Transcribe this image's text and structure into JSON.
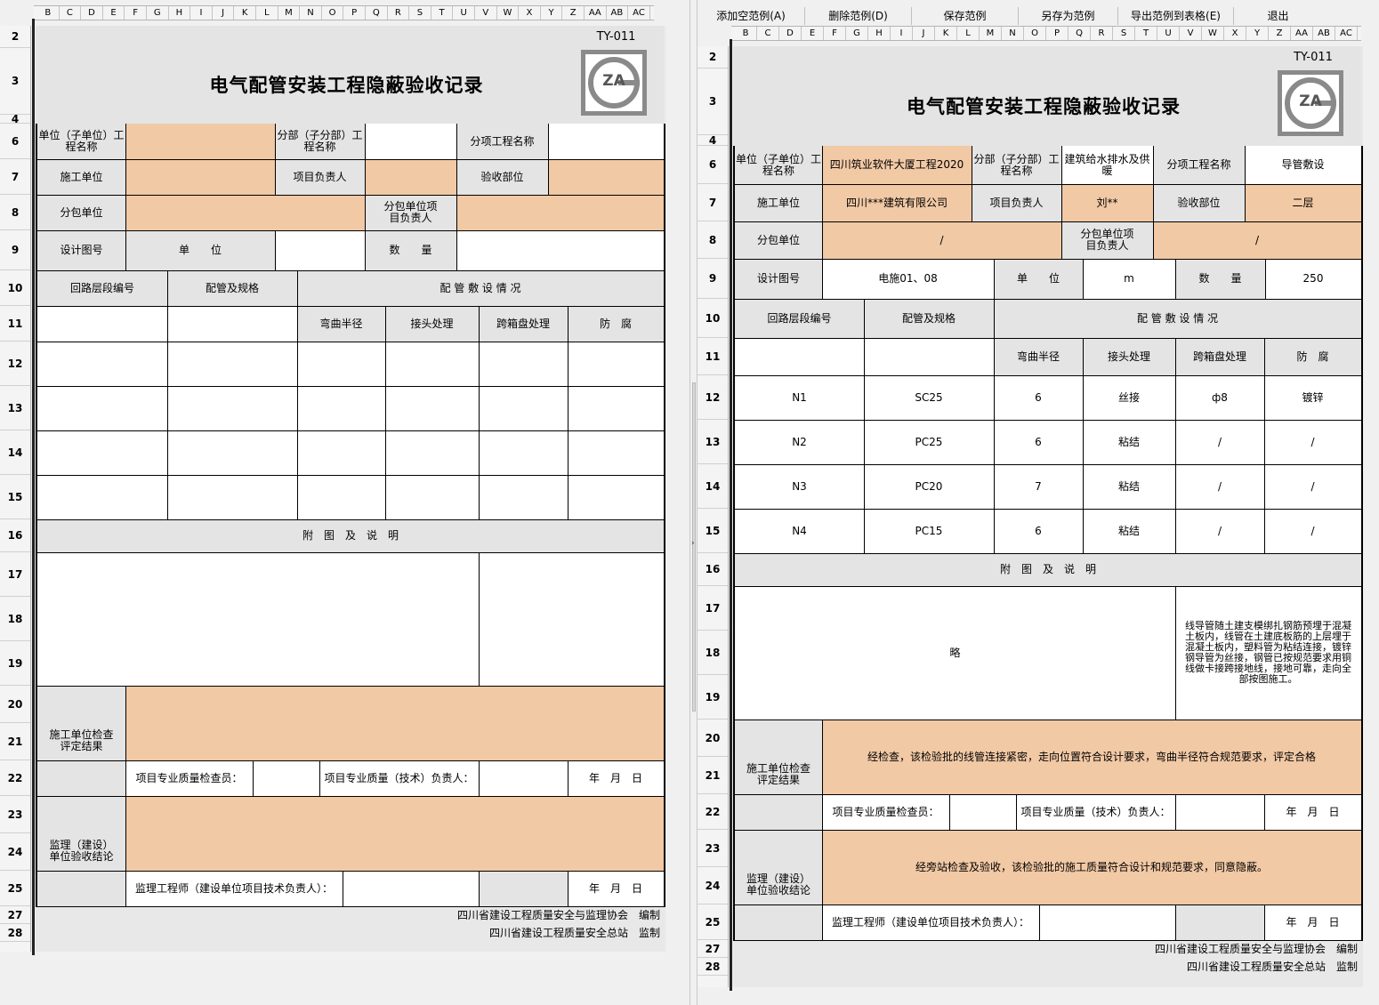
{
  "toolbar": {
    "add": "添加空范例(A)",
    "delete": "删除范例(D)",
    "save": "保存范例",
    "save_as": "另存为范例",
    "export": "导出范例到表格(E)",
    "exit": "退出"
  },
  "columns": [
    "B",
    "C",
    "D",
    "E",
    "F",
    "G",
    "H",
    "I",
    "J",
    "K",
    "L",
    "M",
    "N",
    "O",
    "P",
    "Q",
    "R",
    "S",
    "T",
    "U",
    "V",
    "W",
    "X",
    "Y",
    "Z",
    "AA",
    "AB",
    "AC"
  ],
  "rows": [
    "2",
    "3",
    "4",
    "6",
    "7",
    "8",
    "9",
    "10",
    "11",
    "12",
    "13",
    "14",
    "15",
    "16",
    "17",
    "18",
    "19",
    "20",
    "21",
    "22",
    "23",
    "24",
    "25",
    "27",
    "28"
  ],
  "form": {
    "code": "TY-011",
    "logo_text": "ZA",
    "title": "电气配管安装工程隐蔽验收记录",
    "unit_label": "单位（子单位）工程名称",
    "division_label": "分部（子分部）工程名称",
    "subitem_label": "分项工程名称",
    "contractor_label": "施工单位",
    "pm_label": "项目负责人",
    "part_label": "验收部位",
    "subcontractor_label": "分包单位",
    "sub_pm_label": "分包单位项目负责人",
    "drawing_label": "设计图号",
    "danwei_label": "单　　位",
    "qty_label": "数　　量",
    "h_circuit": "回路层段编号",
    "h_pipe": "配管及规格",
    "h_laying": "配 管 敷 设 情 况",
    "h_bend": "弯曲半径",
    "h_joint": "接头处理",
    "h_box": "跨箱盘处理",
    "h_corr": "防　腐",
    "attach_label": "附　图　及　说　明",
    "check_label": "施工单位检查评定结果",
    "inspector_label": "项目专业质量检查员：",
    "tech_label": "项目专业质量（技术）负责人：",
    "date_label": "年　月　日",
    "supervise_label": "监理（建设）单位验收结论",
    "engineer_label": "监理工程师（建设单位项目技术负责人）：",
    "footer1": "四川省建设工程质量安全与监理协会　编制",
    "footer2": "四川省建设工程质量安全总站　监制"
  },
  "filled": {
    "unit_value": "四川筑业软件大厦工程2020",
    "division_value": "建筑给水排水及供暖",
    "subitem_value": "导管敷设",
    "contractor_value": "四川***建筑有限公司",
    "pm_value": "刘**",
    "part_value": "二层",
    "subcontractor_value": "/",
    "sub_pm_value": "/",
    "drawing_value": "电施01、08",
    "danwei_value": "m",
    "qty_value": "250",
    "rows": [
      {
        "circuit": "N1",
        "pipe": "SC25",
        "bend": "6",
        "joint": "丝接",
        "box": "ф8",
        "corr": "镀锌"
      },
      {
        "circuit": "N2",
        "pipe": "PC25",
        "bend": "6",
        "joint": "粘结",
        "box": "/",
        "corr": "/"
      },
      {
        "circuit": "N3",
        "pipe": "PC20",
        "bend": "7",
        "joint": "粘结",
        "box": "/",
        "corr": "/"
      },
      {
        "circuit": "N4",
        "pipe": "PC15",
        "bend": "6",
        "joint": "粘结",
        "box": "/",
        "corr": "/"
      }
    ],
    "attach_left": "略",
    "attach_right": "线导管随土建支模绑扎钢筋预埋于混凝土板内，线管在土建底板筋的上层埋于混凝土板内，塑料管为粘结连接，镀锌钢导管为丝接，钢管已按规范要求用铜线做卡接跨接地线，接地可靠，走向全部按图施工。",
    "check_result": "经检查，该检验批的线管连接紧密，走向位置符合设计要求，弯曲半径符合规范要求，评定合格",
    "supervise_result": "经旁站检查及验收，该检验批的施工质量符合设计和规范要求，同意隐蔽。"
  },
  "colors": {
    "orange": "#f2c9a5",
    "gray": "#e4e4e4",
    "background": "#f0f0f0"
  }
}
